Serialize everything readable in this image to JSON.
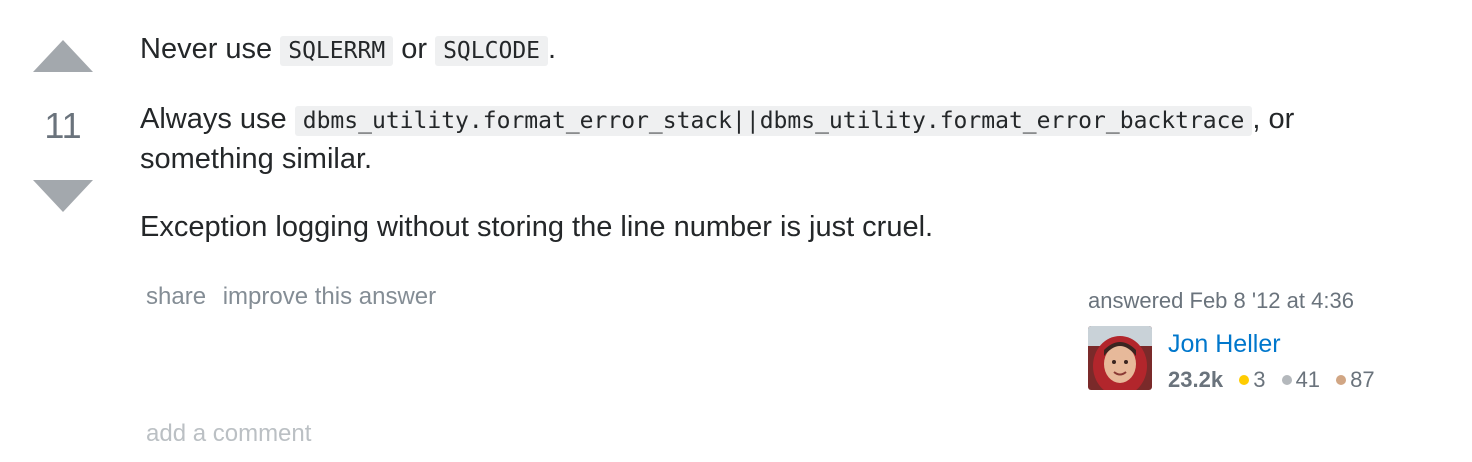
{
  "vote": {
    "count": "11"
  },
  "post": {
    "p1": {
      "before": "Never use ",
      "code1": "SQLERRM",
      "mid": " or ",
      "code2": "SQLCODE",
      "after": "."
    },
    "p2": {
      "before": "Always use ",
      "code": "dbms_utility.format_error_stack||dbms_utility.format_error_backtrace",
      "after": ", or something similar."
    },
    "p3": "Exception logging without storing the line number is just cruel."
  },
  "menu": {
    "share": "share",
    "improve": "improve this answer"
  },
  "signature": {
    "action": "answered Feb 8 '12 at 4:36",
    "user_name": "Jon Heller",
    "reputation": "23.2k",
    "gold": "3",
    "silver": "41",
    "bronze": "87",
    "colors": {
      "gold": "#ffcc01",
      "silver": "#b4b8bc",
      "bronze": "#d1a684",
      "link": "#0077cc"
    }
  },
  "comments": {
    "add_label": "add a comment"
  }
}
